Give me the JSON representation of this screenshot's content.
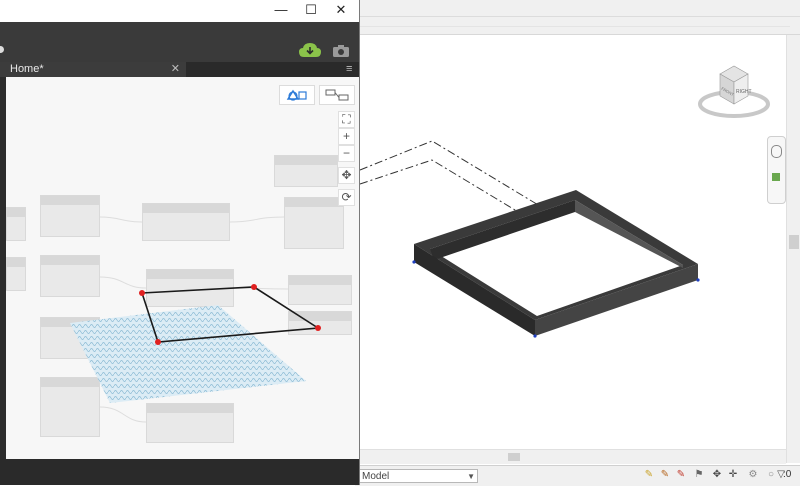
{
  "dynamo": {
    "tab_label": "Home*",
    "tab_close": "✕",
    "tab_menu": "≡",
    "window_controls": {
      "minimize": "—",
      "maximize": "☐",
      "close": "✕"
    },
    "toolbar_icons": [
      "cloud-download-icon",
      "camera-icon"
    ],
    "zoom_controls": {
      "fit": "⛶",
      "zoom_in": "+",
      "zoom_out": "−",
      "pan": "✥",
      "orbit": "⟳"
    }
  },
  "revit": {
    "view_select_value": "Model",
    "filter_count": ":0",
    "viewcube": {
      "top_face": "TOP",
      "front_face": "FRONT",
      "right_face": "RIGHT"
    }
  },
  "colors": {
    "dynamo_dark": "#2c2c2c",
    "accent_green": "#8bc34a",
    "point_red": "#e02020",
    "solid_dark": "#3a3a3a"
  }
}
